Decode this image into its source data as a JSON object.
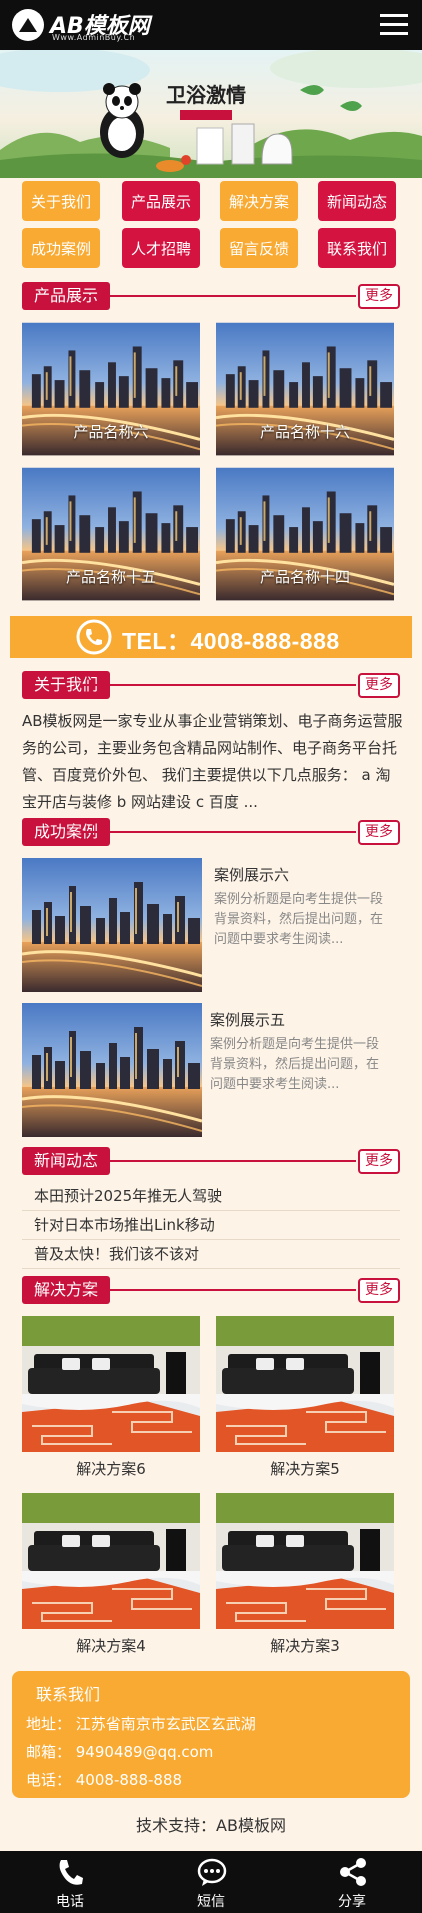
{
  "header": {
    "logo_text": "AB模板网",
    "logo_sub": "Www.AdminBuy.Cn"
  },
  "banner": {
    "calligraphy": "卫浴激情",
    "tag": ""
  },
  "nav": [
    {
      "label": "关于我们",
      "style": "orange"
    },
    {
      "label": "产品展示",
      "style": "red"
    },
    {
      "label": "解决方案",
      "style": "orange"
    },
    {
      "label": "新闻动态",
      "style": "red"
    },
    {
      "label": "成功案例",
      "style": "orange"
    },
    {
      "label": "人才招聘",
      "style": "red"
    },
    {
      "label": "留言反馈",
      "style": "orange"
    },
    {
      "label": "联系我们",
      "style": "red"
    }
  ],
  "more_label": "更多",
  "products": {
    "title": "产品展示",
    "items": [
      "产品名称六",
      "产品名称十六",
      "产品名称十五",
      "产品名称十四"
    ]
  },
  "tel": {
    "text": "TEL：4008-888-888"
  },
  "about": {
    "title": "关于我们",
    "text": "AB模板网是一家专业从事企业营销策划、电子商务运营服务的公司，主要业务包含精品网站制作、电子商务平台托管、百度竞价外包、 我们主要提供以下几点服务： a 淘宝开店与装修 b 网站建设 c 百度 ..."
  },
  "cases": {
    "title": "成功案例",
    "items": [
      {
        "title": "案例展示六",
        "desc": "案例分析题是向考生提供一段背景资料，然后提出问题，在问题中要求考生阅读..."
      },
      {
        "title": "案例展示五",
        "desc": "案例分析题是向考生提供一段背景资料，然后提出问题，在问题中要求考生阅读..."
      }
    ]
  },
  "news": {
    "title": "新闻动态",
    "items": [
      "本田预计2025年推无人驾驶",
      "针对日本市场推出Link移动",
      "普及太快！我们该不该对"
    ]
  },
  "solutions": {
    "title": "解决方案",
    "items": [
      "解决方案6",
      "解决方案5",
      "解决方案4",
      "解决方案3"
    ]
  },
  "contact": {
    "title": "联系我们",
    "address": "地址：  江苏省南京市玄武区玄武湖",
    "email": "邮箱：  9490489@qq.com",
    "phone": "电话：  4008-888-888"
  },
  "support": "技术支持：AB模板网",
  "footer": {
    "items": [
      {
        "label": "电话",
        "icon": "phone-icon"
      },
      {
        "label": "短信",
        "icon": "sms-icon"
      },
      {
        "label": "分享",
        "icon": "share-icon"
      }
    ]
  },
  "colors": {
    "accent_red": "#c8123d",
    "accent_orange": "#f8aa32",
    "bar": "#0e0e0e",
    "page_bg": "#fdf3e7"
  }
}
